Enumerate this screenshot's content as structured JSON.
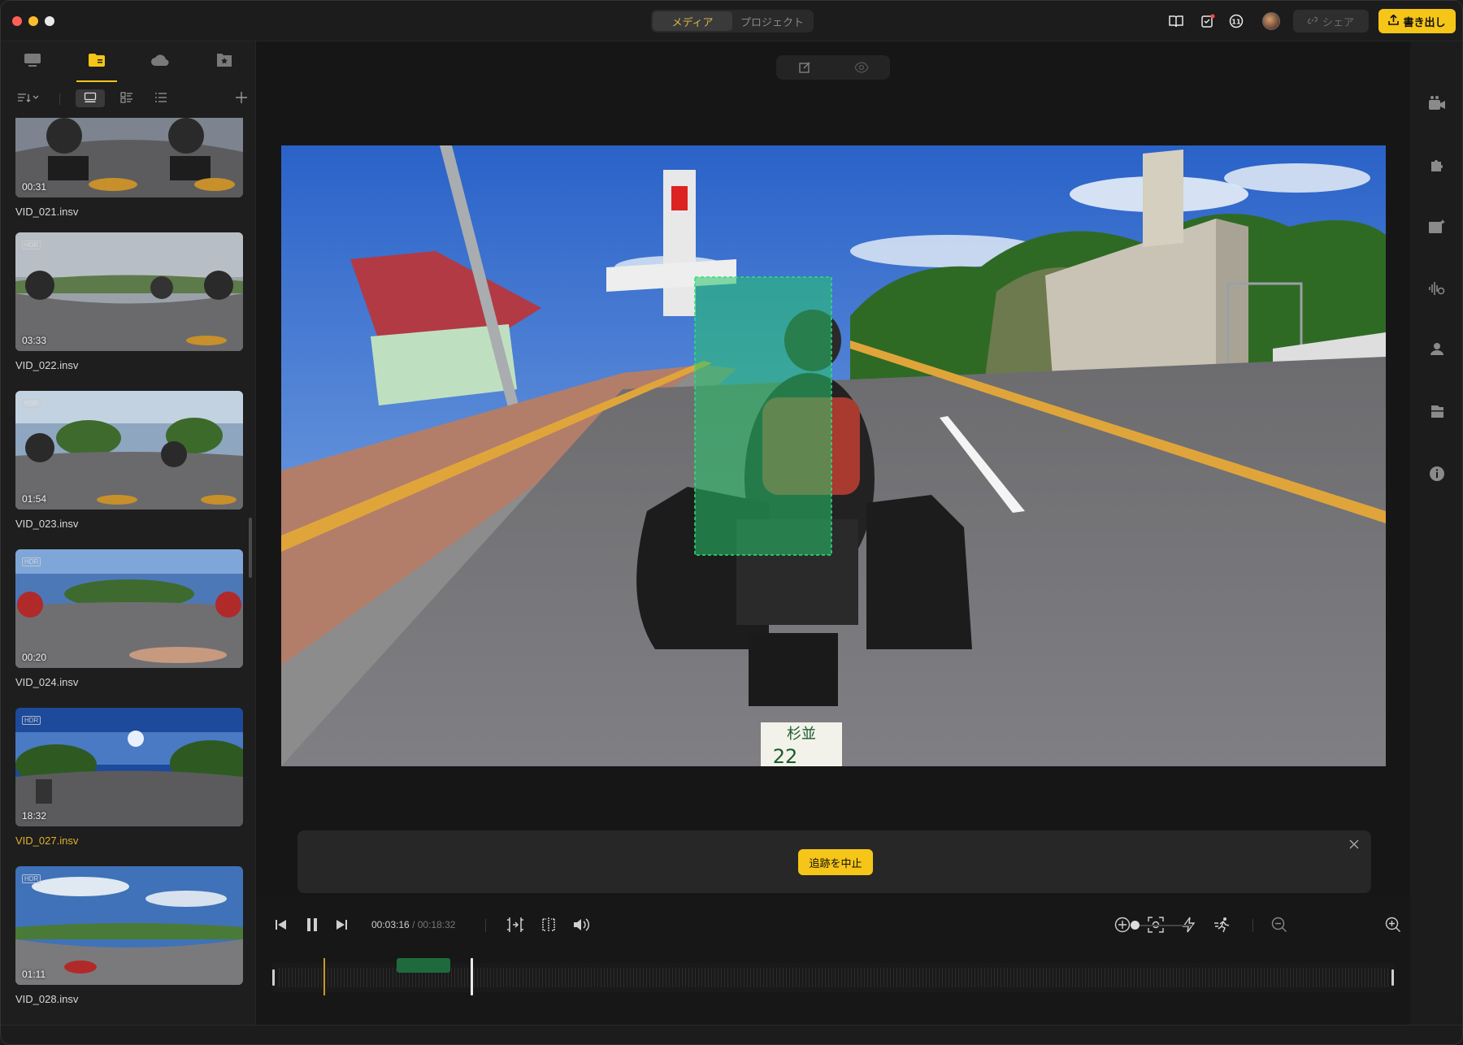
{
  "titlebar": {
    "tabs": [
      {
        "label": "メディア",
        "active": true
      },
      {
        "label": "プロジェクト",
        "active": false
      }
    ],
    "share_label": "シェア",
    "export_label": "書き出し",
    "icons": [
      "book-icon",
      "notes-icon",
      "badge-icon",
      "avatar",
      "share-icon",
      "export-icon"
    ]
  },
  "sidebar": {
    "tabs": [
      "monitor-icon",
      "folder-icon",
      "cloud-icon",
      "favorites-icon"
    ],
    "active_tab": 1,
    "media": [
      {
        "name": "VID_021.insv",
        "duration": "00:31",
        "hdr": false,
        "active": false
      },
      {
        "name": "VID_022.insv",
        "duration": "03:33",
        "hdr": true,
        "active": false
      },
      {
        "name": "VID_023.insv",
        "duration": "01:54",
        "hdr": true,
        "active": false
      },
      {
        "name": "VID_024.insv",
        "duration": "00:20",
        "hdr": true,
        "active": false
      },
      {
        "name": "VID_027.insv",
        "duration": "18:32",
        "hdr": true,
        "hdr_label": "HDR",
        "active": true
      },
      {
        "name": "VID_028.insv",
        "duration": "01:11",
        "hdr": true,
        "active": false
      }
    ]
  },
  "tracking": {
    "stop_label": "追跡を中止"
  },
  "transport": {
    "current_time": "00:03:16",
    "separator": "/",
    "total_time": "00:18:32",
    "playhead_fraction": 0.177
  },
  "colors": {
    "accent": "#f5c518",
    "tracking_box": "#27c46a",
    "active_file": "#e0b030"
  }
}
